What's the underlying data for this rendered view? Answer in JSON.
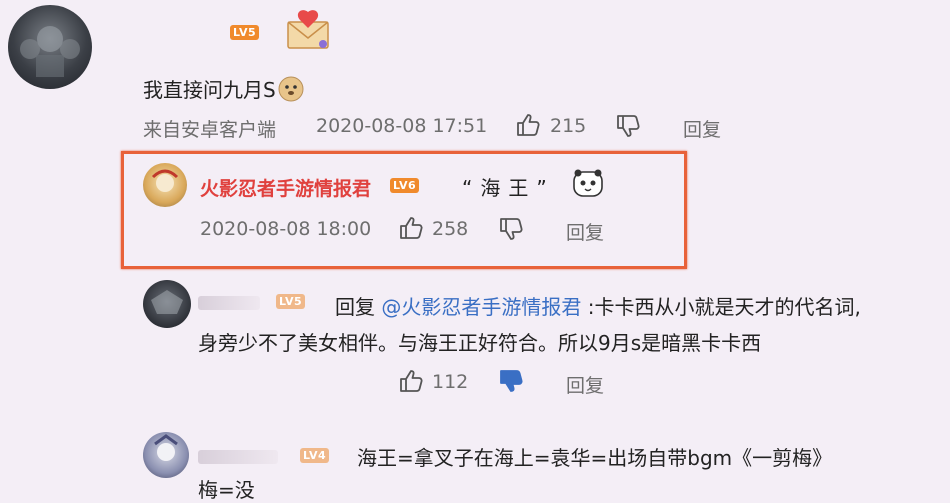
{
  "comment1": {
    "level": "LV5",
    "text": "我直接问九月S",
    "source": "来自安卓客户端",
    "time": "2020-08-08 17:51",
    "likes": "215",
    "reply_label": "回复"
  },
  "comment2": {
    "user": "火影忍者手游情报君",
    "level": "LV6",
    "text": "“海王”",
    "time": "2020-08-08 18:00",
    "likes": "258",
    "reply_label": "回复"
  },
  "comment3": {
    "level": "LV5",
    "reply_prefix": "回复",
    "mention": "@火影忍者手游情报君",
    "text_line1": ":卡卡西从小就是天才的代名词,",
    "text_line2": "身旁少不了美女相伴。与海王正好符合。所以9月s是暗黑卡卡西",
    "likes": "112",
    "reply_label": "回复"
  },
  "comment4": {
    "level": "LV4",
    "text_line1": "海王=拿叉子在海上=袁华=出场自带bgm《一剪梅》",
    "text_line2": "梅=没"
  },
  "colors": {
    "highlight": "#e8623a",
    "username": "#e0413e",
    "link": "#3a6fc4",
    "level_badge": "#f08a2c"
  }
}
